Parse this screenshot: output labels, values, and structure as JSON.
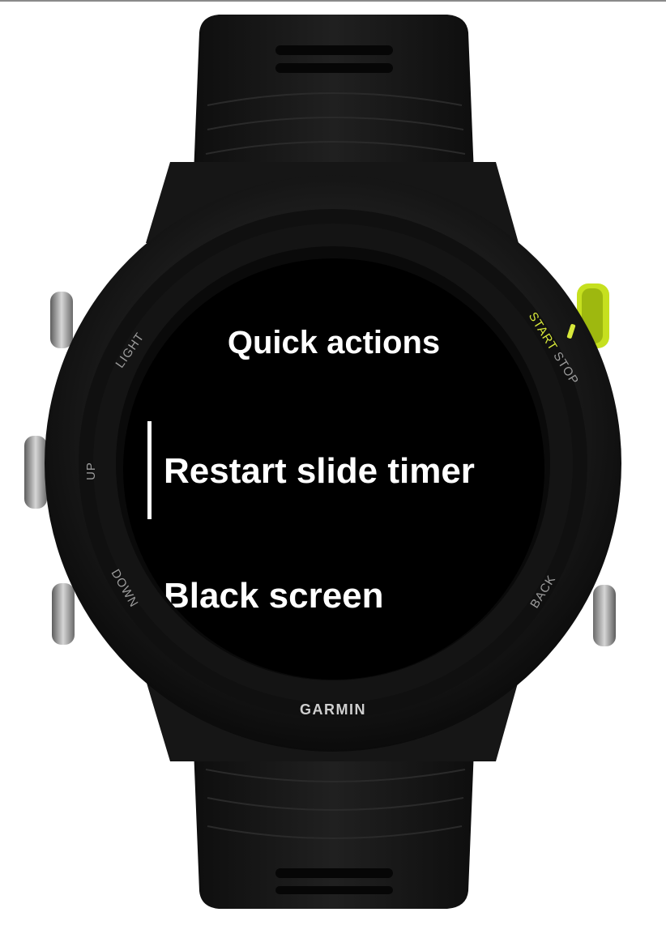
{
  "screen": {
    "title": "Quick actions",
    "items": [
      {
        "label": "Restart slide timer",
        "selected": true
      },
      {
        "label": "Black screen",
        "selected": false
      }
    ]
  },
  "bezel": {
    "light": "LIGHT",
    "up": "UP",
    "down": "DOWN",
    "back": "BACK",
    "start": "START",
    "stop": "STOP"
  },
  "brand": "GARMIN",
  "colors": {
    "accent": "#d7e83a",
    "screen_bg": "#000000",
    "text": "#ffffff",
    "watch_body": "#141414"
  }
}
